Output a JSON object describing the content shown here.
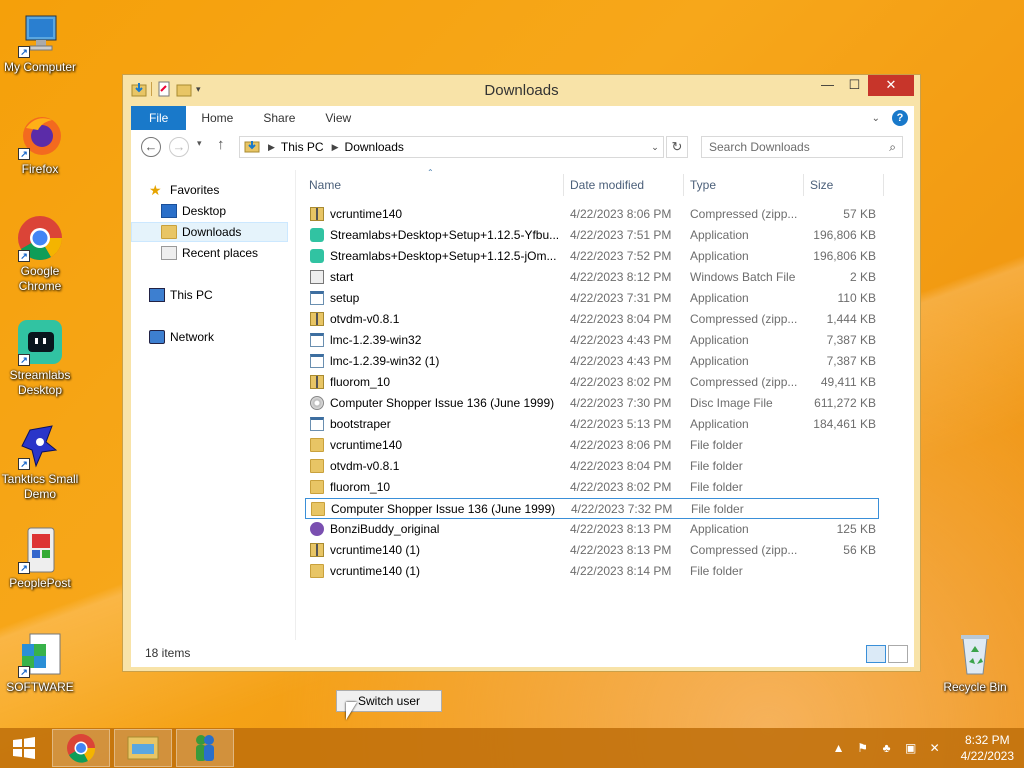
{
  "desktop": {
    "icons": [
      {
        "label": "My Computer",
        "icon": "computer-icon"
      },
      {
        "label": "Firefox",
        "icon": "firefox-icon"
      },
      {
        "label": "Google Chrome",
        "icon": "chrome-icon"
      },
      {
        "label": "Streamlabs Desktop",
        "icon": "streamlabs-icon"
      },
      {
        "label": "Tanktics Small Demo",
        "icon": "tanktics-icon"
      },
      {
        "label": "PeoplePost",
        "icon": "peoplepost-icon"
      },
      {
        "label": "SOFTWARE",
        "icon": "registry-icon"
      },
      {
        "label": "Recycle Bin",
        "icon": "recycle-bin-icon"
      }
    ]
  },
  "window": {
    "title": "Downloads",
    "ribbon_tabs": [
      "File",
      "Home",
      "Share",
      "View"
    ],
    "address": {
      "crumbs": [
        "This PC",
        "Downloads"
      ]
    },
    "search_placeholder": "Search Downloads",
    "nav": {
      "favorites": "Favorites",
      "items": [
        "Desktop",
        "Downloads",
        "Recent places"
      ],
      "this_pc": "This PC",
      "network": "Network"
    },
    "columns": {
      "name": "Name",
      "date": "Date modified",
      "type": "Type",
      "size": "Size"
    },
    "files": [
      {
        "name": "vcruntime140",
        "date": "4/22/2023 8:06 PM",
        "type": "Compressed (zipp...",
        "size": "57 KB",
        "kind": "zip"
      },
      {
        "name": "Streamlabs+Desktop+Setup+1.12.5-Yfbu...",
        "date": "4/22/2023 7:51 PM",
        "type": "Application",
        "size": "196,806 KB",
        "kind": "streamlabs"
      },
      {
        "name": "Streamlabs+Desktop+Setup+1.12.5-jOm...",
        "date": "4/22/2023 7:52 PM",
        "type": "Application",
        "size": "196,806 KB",
        "kind": "streamlabs"
      },
      {
        "name": "start",
        "date": "4/22/2023 8:12 PM",
        "type": "Windows Batch File",
        "size": "2 KB",
        "kind": "bat"
      },
      {
        "name": "setup",
        "date": "4/22/2023 7:31 PM",
        "type": "Application",
        "size": "110 KB",
        "kind": "app"
      },
      {
        "name": "otvdm-v0.8.1",
        "date": "4/22/2023 8:04 PM",
        "type": "Compressed (zipp...",
        "size": "1,444 KB",
        "kind": "zip"
      },
      {
        "name": "lmc-1.2.39-win32",
        "date": "4/22/2023 4:43 PM",
        "type": "Application",
        "size": "7,387 KB",
        "kind": "app"
      },
      {
        "name": "lmc-1.2.39-win32 (1)",
        "date": "4/22/2023 4:43 PM",
        "type": "Application",
        "size": "7,387 KB",
        "kind": "app"
      },
      {
        "name": "fluorom_10",
        "date": "4/22/2023 8:02 PM",
        "type": "Compressed (zipp...",
        "size": "49,411 KB",
        "kind": "zip"
      },
      {
        "name": "Computer Shopper Issue 136 (June 1999) ...",
        "date": "4/22/2023 7:30 PM",
        "type": "Disc Image File",
        "size": "611,272 KB",
        "kind": "disc"
      },
      {
        "name": "bootstraper",
        "date": "4/22/2023 5:13 PM",
        "type": "Application",
        "size": "184,461 KB",
        "kind": "app"
      },
      {
        "name": "vcruntime140",
        "date": "4/22/2023 8:06 PM",
        "type": "File folder",
        "size": "",
        "kind": "folder"
      },
      {
        "name": "otvdm-v0.8.1",
        "date": "4/22/2023 8:04 PM",
        "type": "File folder",
        "size": "",
        "kind": "folder"
      },
      {
        "name": "fluorom_10",
        "date": "4/22/2023 8:02 PM",
        "type": "File folder",
        "size": "",
        "kind": "folder"
      },
      {
        "name": "Computer Shopper Issue 136 (June 1999) ...",
        "date": "4/22/2023 7:32 PM",
        "type": "File folder",
        "size": "",
        "kind": "folder",
        "selected": true
      },
      {
        "name": "BonziBuddy_original",
        "date": "4/22/2023 8:13 PM",
        "type": "Application",
        "size": "125 KB",
        "kind": "bonzi"
      },
      {
        "name": "vcruntime140 (1)",
        "date": "4/22/2023 8:13 PM",
        "type": "Compressed (zipp...",
        "size": "56 KB",
        "kind": "zip"
      },
      {
        "name": "vcruntime140 (1)",
        "date": "4/22/2023 8:14 PM",
        "type": "File folder",
        "size": "",
        "kind": "folder"
      }
    ],
    "status": "18 items"
  },
  "switch_user": "Switch user",
  "taskbar": {
    "pinned": [
      "chrome-icon",
      "file-explorer-icon",
      "messenger-icon"
    ],
    "clock_time": "8:32 PM",
    "clock_date": "4/22/2023"
  }
}
